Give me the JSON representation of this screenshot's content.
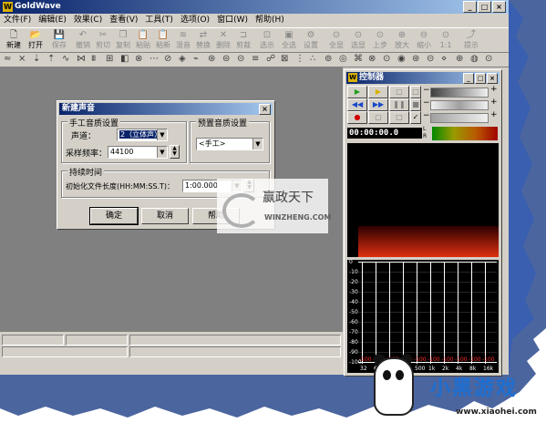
{
  "app": {
    "title": "GoldWave",
    "logo": "W",
    "controls": [
      "_",
      "□",
      "×"
    ]
  },
  "menu": [
    "文件(F)",
    "编辑(E)",
    "效果(C)",
    "查看(V)",
    "工具(T)",
    "选项(O)",
    "窗口(W)",
    "帮助(H)"
  ],
  "toolbar": [
    {
      "label": "新建",
      "icon": "new-file-icon",
      "glyph": "🗋",
      "enabled": true
    },
    {
      "label": "打开",
      "icon": "open-folder-icon",
      "glyph": "📂",
      "enabled": true
    },
    {
      "label": "保存",
      "icon": "save-icon",
      "glyph": "💾",
      "enabled": false
    },
    {
      "label": "撤销",
      "icon": "undo-icon",
      "glyph": "↶",
      "enabled": false
    },
    {
      "label": "剪切",
      "icon": "cut-icon",
      "glyph": "✂",
      "enabled": false
    },
    {
      "label": "复制",
      "icon": "copy-icon",
      "glyph": "❐",
      "enabled": false
    },
    {
      "label": "粘贴",
      "icon": "paste-icon",
      "glyph": "📋",
      "enabled": false
    },
    {
      "label": "粘新",
      "icon": "paste-new-icon",
      "glyph": "📋",
      "enabled": false
    },
    {
      "label": "混音",
      "icon": "mix-icon",
      "glyph": "≋",
      "enabled": false
    },
    {
      "label": "替换",
      "icon": "replace-icon",
      "glyph": "⇄",
      "enabled": false
    },
    {
      "label": "删除",
      "icon": "delete-icon",
      "glyph": "✕",
      "enabled": false
    },
    {
      "label": "剪裁",
      "icon": "trim-icon",
      "glyph": "⊐",
      "enabled": false
    },
    {
      "label": "选示",
      "icon": "select-view-icon",
      "glyph": "⊡",
      "enabled": false
    },
    {
      "label": "全选",
      "icon": "select-all-icon",
      "glyph": "▣",
      "enabled": false
    },
    {
      "label": "设置",
      "icon": "settings-icon",
      "glyph": "⚙",
      "enabled": false
    },
    {
      "label": "全显",
      "icon": "show-all-icon",
      "glyph": "⊙",
      "enabled": false
    },
    {
      "label": "选显",
      "icon": "show-selection-icon",
      "glyph": "⊙",
      "enabled": false
    },
    {
      "label": "上步",
      "icon": "previous-icon",
      "glyph": "⊙",
      "enabled": false
    },
    {
      "label": "放大",
      "icon": "zoom-in-icon",
      "glyph": "⊕",
      "enabled": false
    },
    {
      "label": "缩小",
      "icon": "zoom-out-icon",
      "glyph": "⊖",
      "enabled": false
    },
    {
      "label": "1:1",
      "icon": "actual-size-icon",
      "glyph": "⊙",
      "enabled": false
    },
    {
      "label": "提示",
      "icon": "hint-icon",
      "glyph": "⤴",
      "enabled": false
    }
  ],
  "effects_toolbar_icons": [
    "≈",
    "⨯",
    "⇣",
    "⇡",
    "∿",
    "⋈",
    "⩩",
    "⊞",
    "◧",
    "⊗",
    "⋯",
    "⊘",
    "◈",
    "⌁",
    "⊛",
    "⊜",
    "⊝",
    "≡",
    "☍",
    "⊠",
    "⋮",
    "∴",
    "⊚",
    "◎",
    "⌘",
    "⊗",
    "⊙",
    "◉",
    "⊛",
    "⊝",
    "⋄",
    "⊕",
    "◍",
    "⊙"
  ],
  "dialog": {
    "title": "新建声音",
    "close": "×",
    "quality_group": "手工音质设置",
    "channels_label": "声道：",
    "channels_value": "2（立体声）",
    "samplerate_label": "采样频率：",
    "samplerate_value": "44100",
    "preset_group": "预置音质设置",
    "preset_value": "<手工>",
    "duration_group": "持续时间",
    "length_label": "初始化文件长度(HH:MM:SS.T)：",
    "length_value": "1:00.000",
    "ok": "确定",
    "cancel": "取消",
    "help": "帮助"
  },
  "watermark": {
    "name": "赢政天下",
    "url": "WINZHENG.COM"
  },
  "control": {
    "title": "控制器",
    "time": "00:00:00.0",
    "meter_labels": [
      "L",
      "R"
    ],
    "spectrum_y": [
      "0",
      "-10",
      "-20",
      "-30",
      "-40",
      "-50",
      "-60",
      "-70",
      "-80",
      "-90",
      "-100"
    ],
    "spectrum_x": [
      "32",
      "62",
      "125",
      "250",
      "500",
      "1k",
      "2k",
      "4k",
      "8k",
      "16k"
    ],
    "spectrum_peaks": [
      "-100",
      "-100",
      "-100",
      "-100",
      "-100",
      "-100",
      "-100",
      "-100",
      "-100",
      "-100"
    ]
  },
  "badge": {
    "brand": "小黑游戏",
    "site": "www.xiaohei.com"
  }
}
